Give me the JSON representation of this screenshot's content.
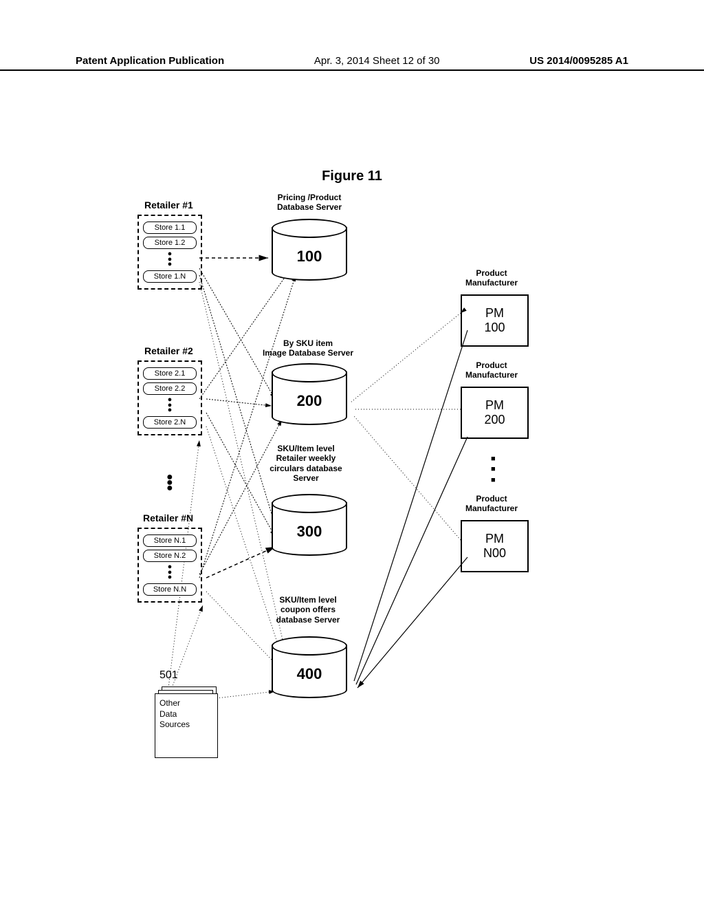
{
  "header": {
    "left": "Patent Application Publication",
    "center": "Apr. 3, 2014  Sheet 12 of 30",
    "right": "US 2014/0095285 A1"
  },
  "figure_title": "Figure 11",
  "retailers": [
    {
      "label": "Retailer #1",
      "stores": [
        "Store 1.1",
        "Store 1.2",
        "Store 1.N"
      ]
    },
    {
      "label": "Retailer #2",
      "stores": [
        "Store 2.1",
        "Store 2.2",
        "Store 2.N"
      ]
    },
    {
      "label": "Retailer #N",
      "stores": [
        "Store N.1",
        "Store N.2",
        "Store N.N"
      ]
    }
  ],
  "databases": [
    {
      "title": "Pricing /Product\nDatabase Server",
      "ref": "100"
    },
    {
      "title": "By SKU item\nImage Database Server",
      "ref": "200"
    },
    {
      "title": "SKU/Item level\nRetailer weekly\ncirculars database\nServer",
      "ref": "300"
    },
    {
      "title": "SKU/Item level\ncoupon offers\ndatabase Server",
      "ref": "400"
    }
  ],
  "manufacturers": [
    {
      "label": "Product\nManufacturer",
      "box_line1": "PM",
      "box_line2": "100"
    },
    {
      "label": "Product\nManufacturer",
      "box_line1": "PM",
      "box_line2": "200"
    },
    {
      "label": "Product\nManufacturer",
      "box_line1": "PM",
      "box_line2": "N00"
    }
  ],
  "other_sources": {
    "ref": "501",
    "label": "Other\nData\nSources"
  }
}
